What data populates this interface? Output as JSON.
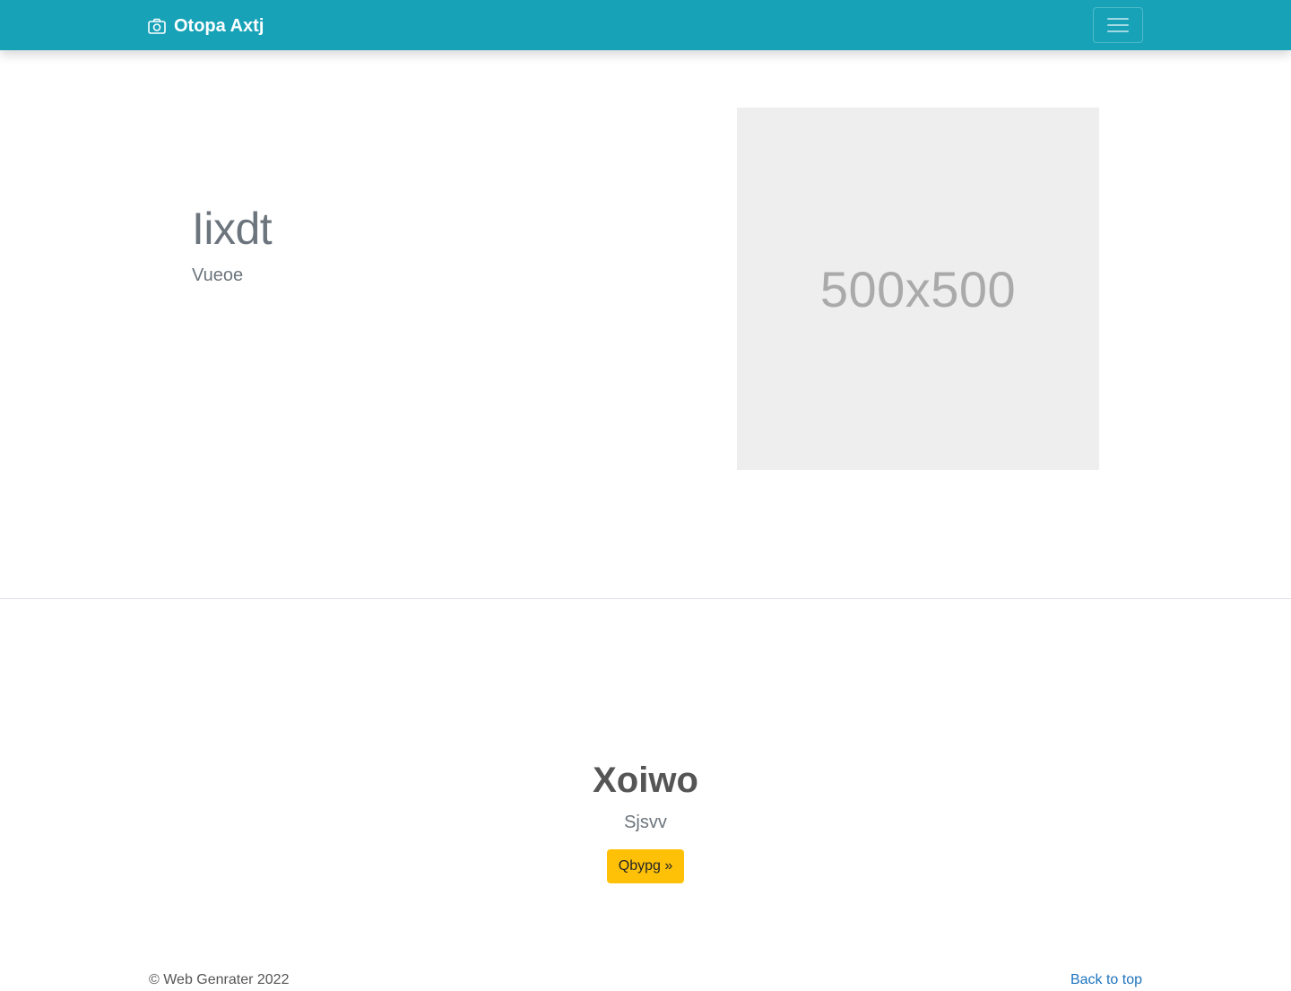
{
  "navbar": {
    "brand_icon": "camera-icon",
    "brand_text": "Otopa Axtj",
    "menu_icon": "hamburger-menu-icon",
    "background_color": "#17a2b8"
  },
  "hero": {
    "title": "Iixdt",
    "subtitle": "Vueoe",
    "placeholder_label": "500x500"
  },
  "section": {
    "title": "Xoiwo",
    "subtitle": "Sjsvv",
    "button_label": "Qbypg »",
    "button_color": "#ffc107"
  },
  "footer": {
    "copyright": "© Web Genrater 2022",
    "back_to_top": "Back to top",
    "link_color": "#1e73be"
  }
}
